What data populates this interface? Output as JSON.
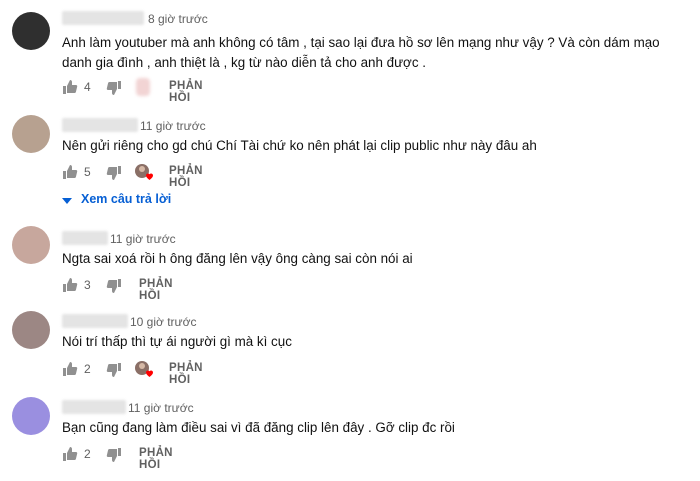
{
  "comments": [
    {
      "time": "8 giờ trước",
      "text": "Anh làm youtuber mà anh không có tâm ,  tại sao lại đưa hồ sơ lên mạng như vậy ?  Và còn dám mạo danh gia đình , anh thiệt là , kg từ nào diễn tả cho anh được .",
      "likes": "4",
      "reply_label": "PHẢN HỒI",
      "avatar_color": "#2f2f2f"
    },
    {
      "time": "11 giờ trước",
      "text": "Nên gửi riêng cho gd chú Chí Tài chứ ko nên phát lại clip public như này đâu ah",
      "likes": "5",
      "reply_label": "PHẢN HỒI",
      "avatar_color": "#b7a190",
      "view_replies": "Xem câu trả lời"
    },
    {
      "time": "11 giờ trước",
      "text": "Ngta sai xoá rồi h ông đăng lên vậy ông càng sai còn nói ai",
      "likes": "3",
      "reply_label": "PHẢN HỒI",
      "avatar_color": "#c7a79d"
    },
    {
      "time": "10 giờ trước",
      "text": "Nói trí thấp thì tự ái người gì mà kì cục",
      "likes": "2",
      "reply_label": "PHẢN HỒI",
      "avatar_color": "#9c8784"
    },
    {
      "time": "11 giờ trước",
      "text": "Bạn cũng đang làm điều sai vì đã đăng clip lên đây  .  Gỡ clip đc rồi",
      "likes": "2",
      "reply_label": "PHẢN HỒI",
      "avatar_color": "#9a8fe0"
    }
  ],
  "colors": {
    "link": "#065fd4",
    "heart": "#ff0000",
    "muted": "#606060"
  }
}
